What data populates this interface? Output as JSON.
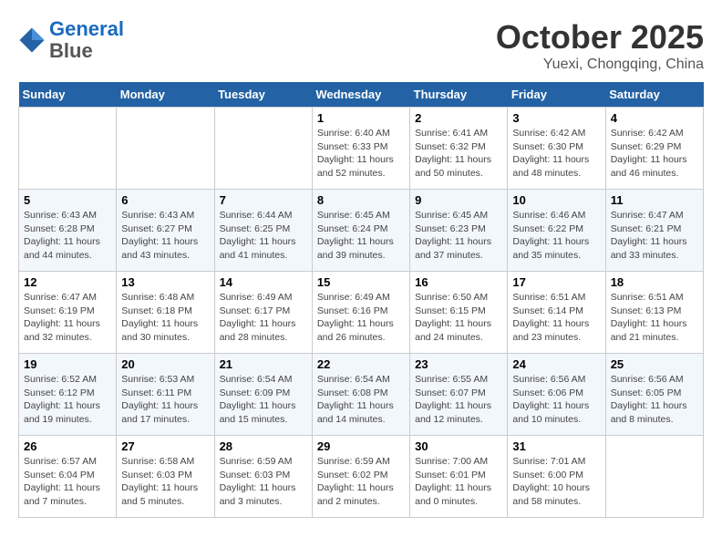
{
  "header": {
    "logo_line1": "General",
    "logo_line2": "Blue",
    "title": "October 2025",
    "subtitle": "Yuexi, Chongqing, China"
  },
  "weekdays": [
    "Sunday",
    "Monday",
    "Tuesday",
    "Wednesday",
    "Thursday",
    "Friday",
    "Saturday"
  ],
  "weeks": [
    [
      {
        "day": "",
        "info": ""
      },
      {
        "day": "",
        "info": ""
      },
      {
        "day": "",
        "info": ""
      },
      {
        "day": "1",
        "info": "Sunrise: 6:40 AM\nSunset: 6:33 PM\nDaylight: 11 hours\nand 52 minutes."
      },
      {
        "day": "2",
        "info": "Sunrise: 6:41 AM\nSunset: 6:32 PM\nDaylight: 11 hours\nand 50 minutes."
      },
      {
        "day": "3",
        "info": "Sunrise: 6:42 AM\nSunset: 6:30 PM\nDaylight: 11 hours\nand 48 minutes."
      },
      {
        "day": "4",
        "info": "Sunrise: 6:42 AM\nSunset: 6:29 PM\nDaylight: 11 hours\nand 46 minutes."
      }
    ],
    [
      {
        "day": "5",
        "info": "Sunrise: 6:43 AM\nSunset: 6:28 PM\nDaylight: 11 hours\nand 44 minutes."
      },
      {
        "day": "6",
        "info": "Sunrise: 6:43 AM\nSunset: 6:27 PM\nDaylight: 11 hours\nand 43 minutes."
      },
      {
        "day": "7",
        "info": "Sunrise: 6:44 AM\nSunset: 6:25 PM\nDaylight: 11 hours\nand 41 minutes."
      },
      {
        "day": "8",
        "info": "Sunrise: 6:45 AM\nSunset: 6:24 PM\nDaylight: 11 hours\nand 39 minutes."
      },
      {
        "day": "9",
        "info": "Sunrise: 6:45 AM\nSunset: 6:23 PM\nDaylight: 11 hours\nand 37 minutes."
      },
      {
        "day": "10",
        "info": "Sunrise: 6:46 AM\nSunset: 6:22 PM\nDaylight: 11 hours\nand 35 minutes."
      },
      {
        "day": "11",
        "info": "Sunrise: 6:47 AM\nSunset: 6:21 PM\nDaylight: 11 hours\nand 33 minutes."
      }
    ],
    [
      {
        "day": "12",
        "info": "Sunrise: 6:47 AM\nSunset: 6:19 PM\nDaylight: 11 hours\nand 32 minutes."
      },
      {
        "day": "13",
        "info": "Sunrise: 6:48 AM\nSunset: 6:18 PM\nDaylight: 11 hours\nand 30 minutes."
      },
      {
        "day": "14",
        "info": "Sunrise: 6:49 AM\nSunset: 6:17 PM\nDaylight: 11 hours\nand 28 minutes."
      },
      {
        "day": "15",
        "info": "Sunrise: 6:49 AM\nSunset: 6:16 PM\nDaylight: 11 hours\nand 26 minutes."
      },
      {
        "day": "16",
        "info": "Sunrise: 6:50 AM\nSunset: 6:15 PM\nDaylight: 11 hours\nand 24 minutes."
      },
      {
        "day": "17",
        "info": "Sunrise: 6:51 AM\nSunset: 6:14 PM\nDaylight: 11 hours\nand 23 minutes."
      },
      {
        "day": "18",
        "info": "Sunrise: 6:51 AM\nSunset: 6:13 PM\nDaylight: 11 hours\nand 21 minutes."
      }
    ],
    [
      {
        "day": "19",
        "info": "Sunrise: 6:52 AM\nSunset: 6:12 PM\nDaylight: 11 hours\nand 19 minutes."
      },
      {
        "day": "20",
        "info": "Sunrise: 6:53 AM\nSunset: 6:11 PM\nDaylight: 11 hours\nand 17 minutes."
      },
      {
        "day": "21",
        "info": "Sunrise: 6:54 AM\nSunset: 6:09 PM\nDaylight: 11 hours\nand 15 minutes."
      },
      {
        "day": "22",
        "info": "Sunrise: 6:54 AM\nSunset: 6:08 PM\nDaylight: 11 hours\nand 14 minutes."
      },
      {
        "day": "23",
        "info": "Sunrise: 6:55 AM\nSunset: 6:07 PM\nDaylight: 11 hours\nand 12 minutes."
      },
      {
        "day": "24",
        "info": "Sunrise: 6:56 AM\nSunset: 6:06 PM\nDaylight: 11 hours\nand 10 minutes."
      },
      {
        "day": "25",
        "info": "Sunrise: 6:56 AM\nSunset: 6:05 PM\nDaylight: 11 hours\nand 8 minutes."
      }
    ],
    [
      {
        "day": "26",
        "info": "Sunrise: 6:57 AM\nSunset: 6:04 PM\nDaylight: 11 hours\nand 7 minutes."
      },
      {
        "day": "27",
        "info": "Sunrise: 6:58 AM\nSunset: 6:03 PM\nDaylight: 11 hours\nand 5 minutes."
      },
      {
        "day": "28",
        "info": "Sunrise: 6:59 AM\nSunset: 6:03 PM\nDaylight: 11 hours\nand 3 minutes."
      },
      {
        "day": "29",
        "info": "Sunrise: 6:59 AM\nSunset: 6:02 PM\nDaylight: 11 hours\nand 2 minutes."
      },
      {
        "day": "30",
        "info": "Sunrise: 7:00 AM\nSunset: 6:01 PM\nDaylight: 11 hours\nand 0 minutes."
      },
      {
        "day": "31",
        "info": "Sunrise: 7:01 AM\nSunset: 6:00 PM\nDaylight: 10 hours\nand 58 minutes."
      },
      {
        "day": "",
        "info": ""
      }
    ]
  ]
}
